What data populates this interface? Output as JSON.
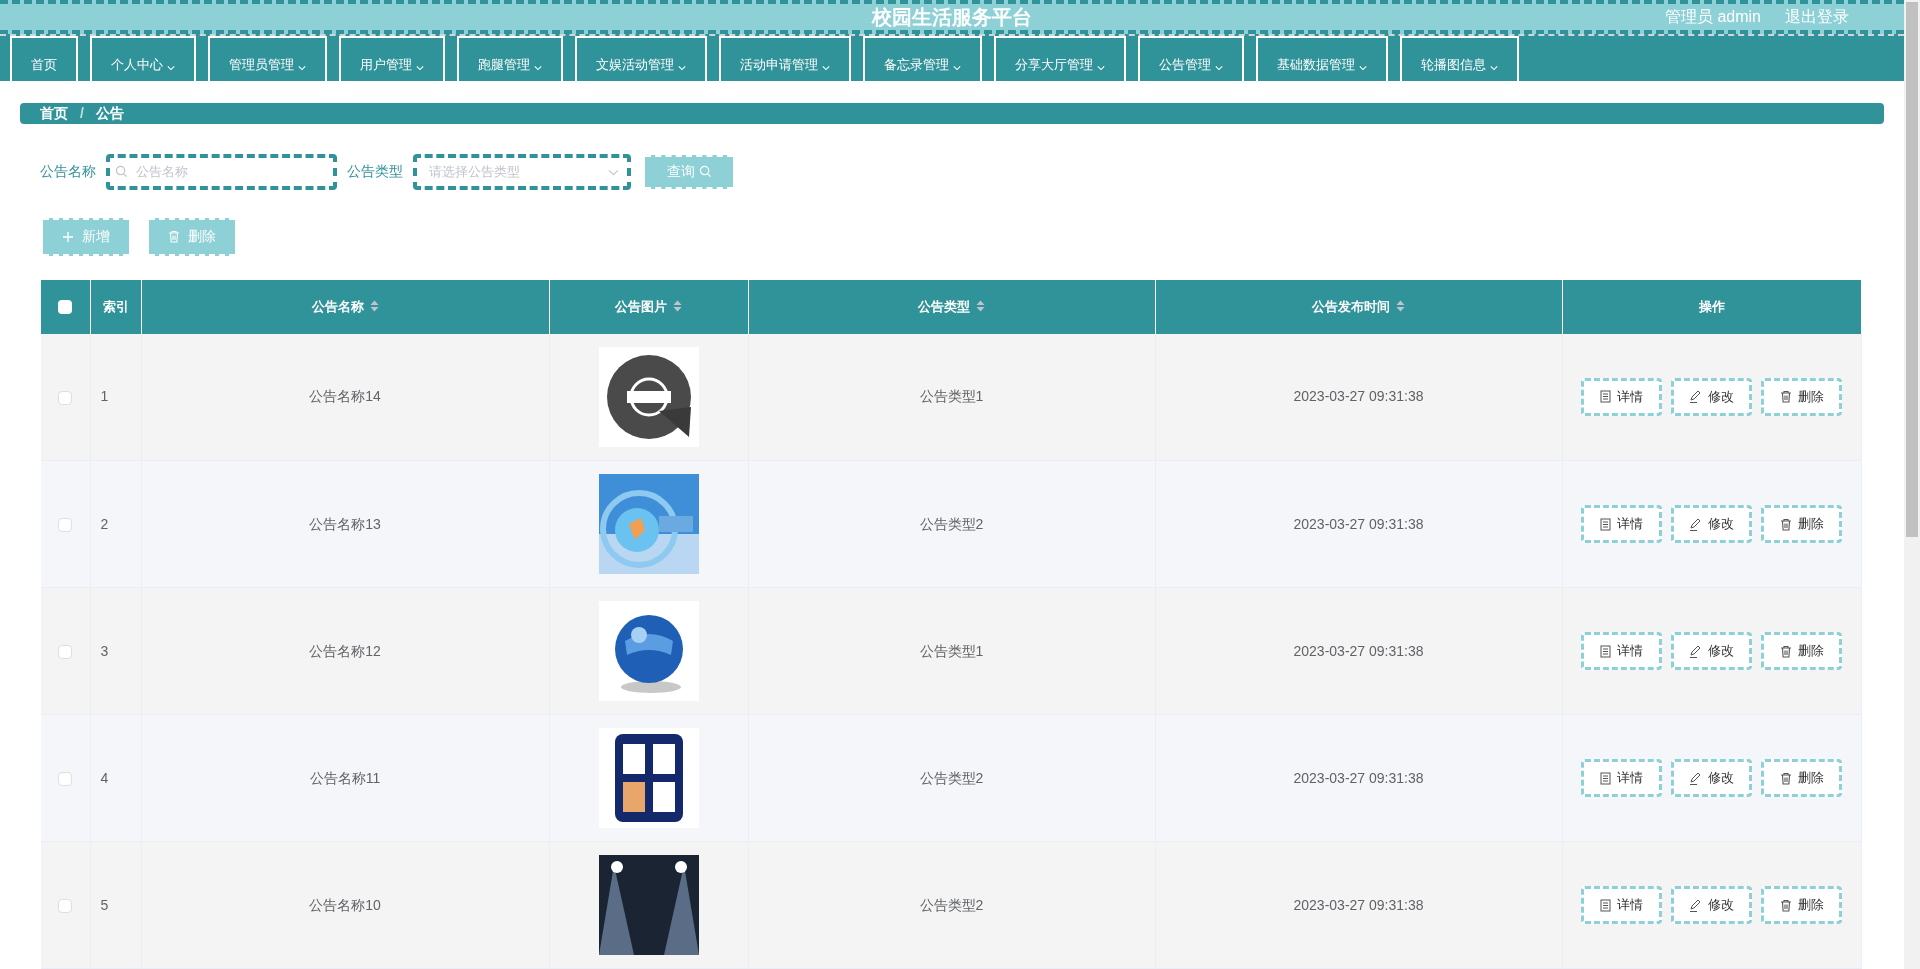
{
  "header": {
    "title": "校园生活服务平台",
    "user": "管理员 admin",
    "logout": "退出登录"
  },
  "nav": [
    {
      "label": "首页",
      "dropdown": false
    },
    {
      "label": "个人中心",
      "dropdown": true
    },
    {
      "label": "管理员管理",
      "dropdown": true
    },
    {
      "label": "用户管理",
      "dropdown": true
    },
    {
      "label": "跑腿管理",
      "dropdown": true
    },
    {
      "label": "文娱活动管理",
      "dropdown": true
    },
    {
      "label": "活动申请管理",
      "dropdown": true
    },
    {
      "label": "备忘录管理",
      "dropdown": true
    },
    {
      "label": "分享大厅管理",
      "dropdown": true
    },
    {
      "label": "公告管理",
      "dropdown": true
    },
    {
      "label": "基础数据管理",
      "dropdown": true
    },
    {
      "label": "轮播图信息",
      "dropdown": true
    }
  ],
  "breadcrumb": {
    "items": [
      "首页",
      "公告"
    ],
    "separator": "/"
  },
  "search": {
    "fields": [
      {
        "label": "公告名称",
        "kind": "input",
        "placeholder": "公告名称"
      },
      {
        "label": "公告类型",
        "kind": "select",
        "placeholder": "请选择公告类型"
      }
    ],
    "button": "查询"
  },
  "actions": [
    {
      "label": "新增",
      "kind": "add"
    },
    {
      "label": "删除",
      "kind": "delete"
    }
  ],
  "table": {
    "all_checked": false,
    "columns": [
      {
        "label": "索引",
        "sortable": false
      },
      {
        "label": "公告名称",
        "sortable": true
      },
      {
        "label": "公告图片",
        "sortable": true
      },
      {
        "label": "公告类型",
        "sortable": true
      },
      {
        "label": "公告发布时间",
        "sortable": true
      },
      {
        "label": "操作",
        "sortable": false
      }
    ],
    "rows": [
      {
        "checked": false,
        "index": "1",
        "name": "公告名称14",
        "type": "公告类型1",
        "time": "2023-03-27 09:31:38",
        "actions": [
          {
            "label": "详情",
            "kind": "detail"
          },
          {
            "label": "修改",
            "kind": "edit"
          },
          {
            "label": "删除",
            "kind": "delete"
          }
        ]
      },
      {
        "checked": false,
        "index": "2",
        "name": "公告名称13",
        "type": "公告类型2",
        "time": "2023-03-27 09:31:38",
        "actions": [
          {
            "label": "详情",
            "kind": "detail"
          },
          {
            "label": "修改",
            "kind": "edit"
          },
          {
            "label": "删除",
            "kind": "delete"
          }
        ]
      },
      {
        "checked": false,
        "index": "3",
        "name": "公告名称12",
        "type": "公告类型1",
        "time": "2023-03-27 09:31:38",
        "actions": [
          {
            "label": "详情",
            "kind": "detail"
          },
          {
            "label": "修改",
            "kind": "edit"
          },
          {
            "label": "删除",
            "kind": "delete"
          }
        ]
      },
      {
        "checked": false,
        "index": "4",
        "name": "公告名称11",
        "type": "公告类型2",
        "time": "2023-03-27 09:31:38",
        "actions": [
          {
            "label": "详情",
            "kind": "detail"
          },
          {
            "label": "修改",
            "kind": "edit"
          },
          {
            "label": "删除",
            "kind": "delete"
          }
        ]
      },
      {
        "checked": false,
        "index": "5",
        "name": "公告名称10",
        "type": "公告类型2",
        "time": "2023-03-27 09:31:38",
        "actions": [
          {
            "label": "详情",
            "kind": "detail"
          },
          {
            "label": "修改",
            "kind": "edit"
          },
          {
            "label": "删除",
            "kind": "delete"
          }
        ]
      }
    ]
  }
}
